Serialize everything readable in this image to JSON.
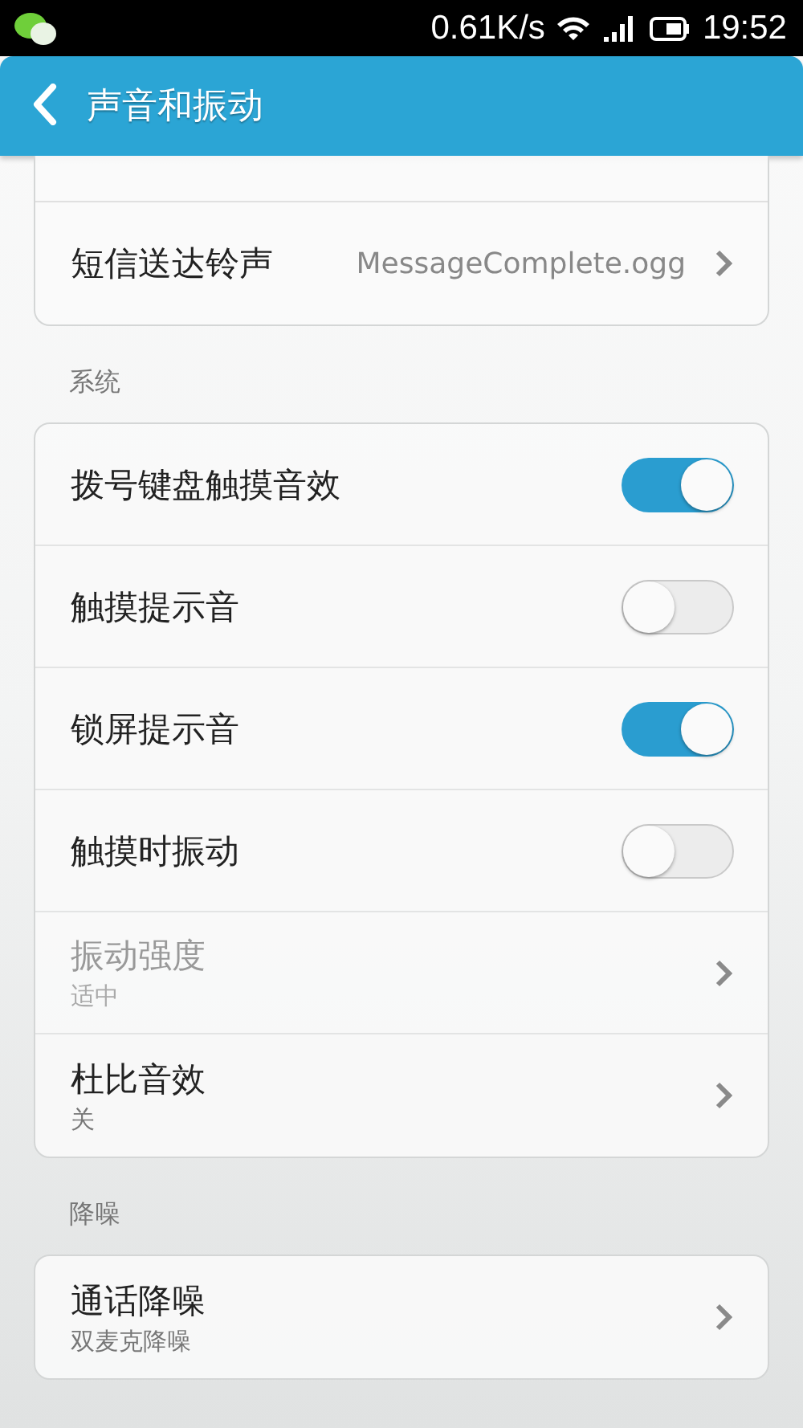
{
  "status_bar": {
    "speed": "0.61K/s",
    "time": "19:52"
  },
  "header": {
    "title": "声音和振动"
  },
  "sections": [
    {
      "partial_top": true,
      "items": [
        {
          "kind": "value",
          "title": "短信送达铃声",
          "value": "MessageComplete.ogg",
          "disabled": false
        }
      ]
    },
    {
      "label": "系统",
      "items": [
        {
          "kind": "switch",
          "title": "拨号键盘触摸音效",
          "on": true,
          "disabled": false
        },
        {
          "kind": "switch",
          "title": "触摸提示音",
          "on": false,
          "disabled": false
        },
        {
          "kind": "switch",
          "title": "锁屏提示音",
          "on": true,
          "disabled": false
        },
        {
          "kind": "switch",
          "title": "触摸时振动",
          "on": false,
          "disabled": false
        },
        {
          "kind": "summary",
          "title": "振动强度",
          "summary": "适中",
          "disabled": true
        },
        {
          "kind": "summary",
          "title": "杜比音效",
          "summary": "关",
          "disabled": false
        }
      ]
    },
    {
      "label": "降噪",
      "items": [
        {
          "kind": "summary",
          "title": "通话降噪",
          "summary": "双麦克降噪",
          "disabled": false
        }
      ]
    }
  ]
}
